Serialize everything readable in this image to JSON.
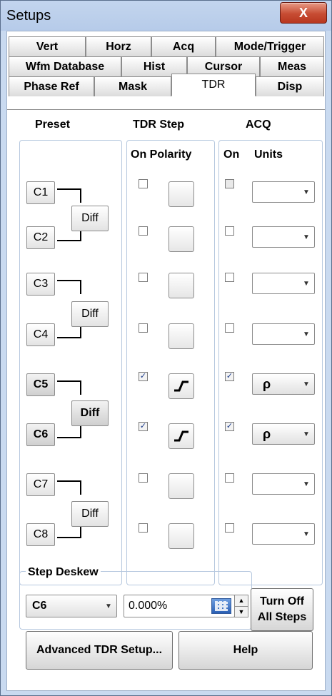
{
  "window": {
    "title": "Setups",
    "close_label": "X",
    "accent_close": "#c74c33"
  },
  "tabs_row1": [
    "Vert",
    "Horz",
    "Acq",
    "Mode/Trigger"
  ],
  "tabs_row2": [
    "Wfm Database",
    "Hist",
    "Cursor",
    "Meas"
  ],
  "tabs_row3": [
    "Phase Ref",
    "Mask",
    "TDR",
    "Disp"
  ],
  "active_tab": "TDR",
  "headers": {
    "preset": "Preset",
    "tdr_step": "TDR Step",
    "acq": "ACQ",
    "on_polarity": "On Polarity",
    "on": "On",
    "units": "Units"
  },
  "preset": {
    "channels": [
      "C1",
      "C2",
      "C3",
      "C4",
      "C5",
      "C6",
      "C7",
      "C8"
    ],
    "diff_label": "Diff"
  },
  "rows": [
    {
      "step_on": false,
      "polarity": "",
      "acq_on": false,
      "units": ""
    },
    {
      "step_on": false,
      "polarity": "",
      "acq_on": false,
      "units": ""
    },
    {
      "step_on": false,
      "polarity": "",
      "acq_on": false,
      "units": ""
    },
    {
      "step_on": false,
      "polarity": "",
      "acq_on": false,
      "units": ""
    },
    {
      "step_on": true,
      "polarity": "rising-step",
      "acq_on": true,
      "units": "ρ"
    },
    {
      "step_on": true,
      "polarity": "rising-step",
      "acq_on": true,
      "units": "ρ"
    },
    {
      "step_on": false,
      "polarity": "",
      "acq_on": false,
      "units": ""
    },
    {
      "step_on": false,
      "polarity": "",
      "acq_on": false,
      "units": ""
    }
  ],
  "step_deskew": {
    "label": "Step Deskew",
    "source": "C6",
    "value": "0.000%",
    "keypad_icon": "keypad-icon"
  },
  "turn_off_all_steps": {
    "line1": "Turn Off",
    "line2": "All Steps"
  },
  "advanced_button": "Advanced TDR Setup...",
  "help_button": "Help"
}
